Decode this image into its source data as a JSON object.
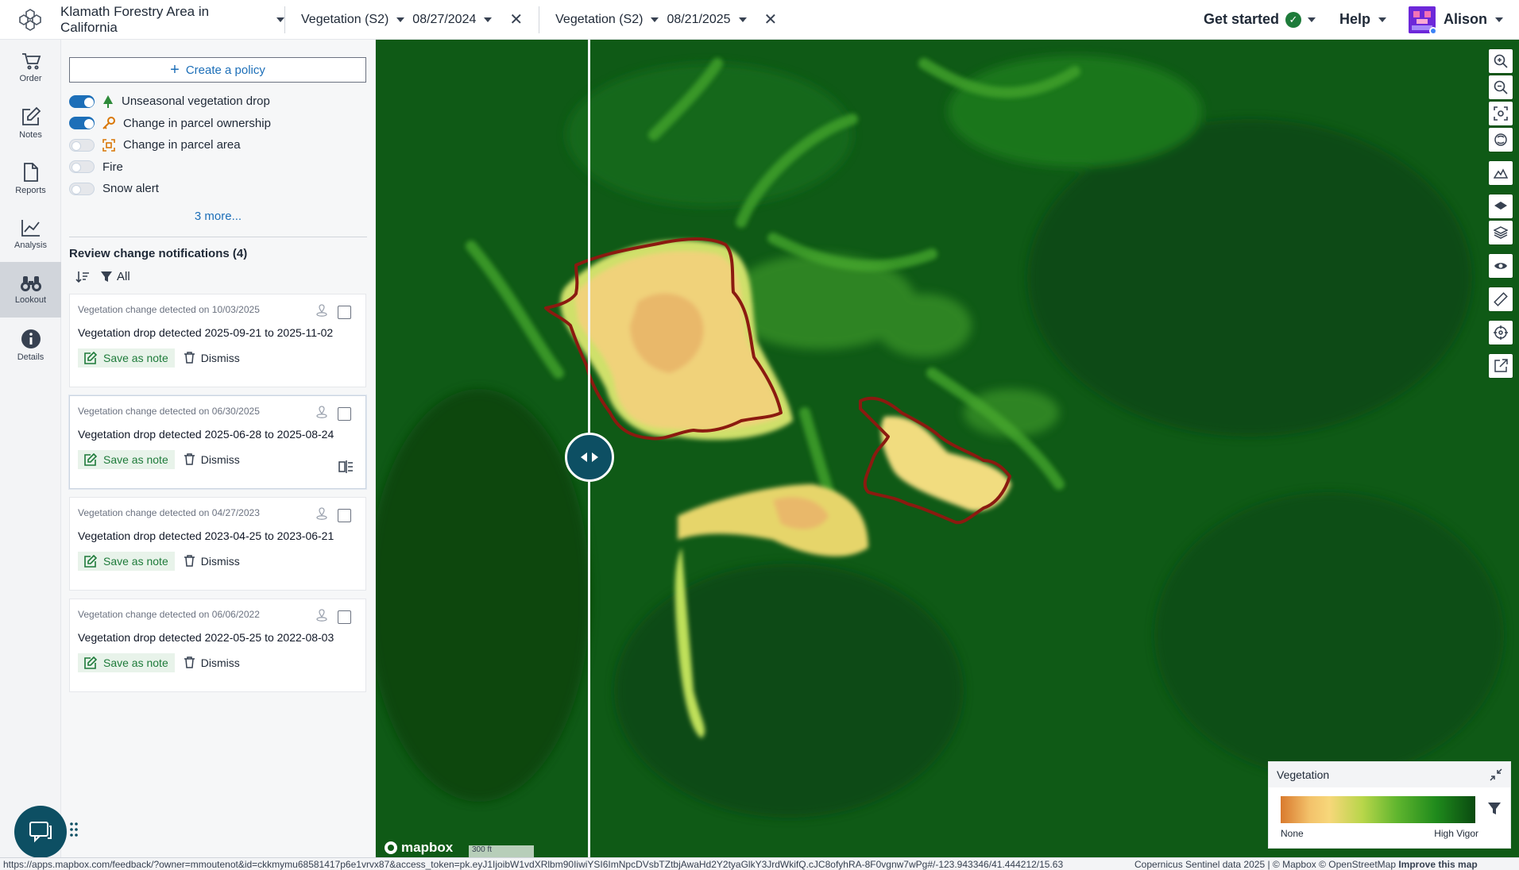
{
  "topbar": {
    "project": "Klamath Forestry Area in California",
    "left_layer": {
      "name": "Vegetation (S2)",
      "date": "08/27/2024"
    },
    "right_layer": {
      "name": "Vegetation (S2)",
      "date": "08/21/2025"
    },
    "get_started": "Get started",
    "help": "Help",
    "user": "Alison"
  },
  "rail": {
    "items": [
      {
        "label": "Order",
        "icon": "cart-icon"
      },
      {
        "label": "Notes",
        "icon": "note-edit-icon"
      },
      {
        "label": "Reports",
        "icon": "document-icon"
      },
      {
        "label": "Analysis",
        "icon": "chart-line-icon"
      },
      {
        "label": "Lookout",
        "icon": "binoculars-icon"
      },
      {
        "label": "Details",
        "icon": "info-icon"
      }
    ]
  },
  "panel": {
    "create_policy": "Create a policy",
    "policies": [
      {
        "label": "Unseasonal vegetation drop",
        "on": true,
        "icon": "tree-icon"
      },
      {
        "label": "Change in parcel ownership",
        "on": true,
        "icon": "key-icon"
      },
      {
        "label": "Change in parcel area",
        "on": false,
        "icon": "area-icon"
      },
      {
        "label": "Fire",
        "on": false
      },
      {
        "label": "Snow alert",
        "on": false
      }
    ],
    "more": "3 more...",
    "review_title": "Review change notifications (4)",
    "filter_label": "All",
    "notifications": [
      {
        "meta": "Vegetation change detected on 10/03/2025",
        "title": "Vegetation drop detected 2025-09-21 to 2025-11-02"
      },
      {
        "meta": "Vegetation change detected on 06/30/2025",
        "title": "Vegetation drop detected 2025-06-28 to 2025-08-24"
      },
      {
        "meta": "Vegetation change detected on 04/27/2023",
        "title": "Vegetation drop detected 2023-04-25 to 2023-06-21"
      },
      {
        "meta": "Vegetation change detected on 06/06/2022",
        "title": "Vegetation drop detected 2022-05-25 to 2022-08-03"
      }
    ],
    "save_note": "Save as note",
    "dismiss": "Dismiss"
  },
  "legend": {
    "title": "Vegetation",
    "low": "None",
    "high": "High Vigor"
  },
  "map": {
    "mapbox_logo": "mapbox",
    "scale": "300 ft"
  },
  "status": {
    "url": "https://apps.mapbox.com/feedback/?owner=mmoutenot&id=ckkmymu68581417p6e1vrvx87&access_token=pk.eyJ1IjoibW1vdXRlbm90IiwiYSI6ImNpcDVsbTZtbjAwaHd2Y2tyaGlkY3JrdWkifQ.cJC8ofyhRA-8F0vgnw7wPg#/-123.943346/41.444212/15.63",
    "attribution": "Copernicus Sentinel data 2025 | © Mapbox © OpenStreetMap",
    "improve": "Improve this map"
  }
}
